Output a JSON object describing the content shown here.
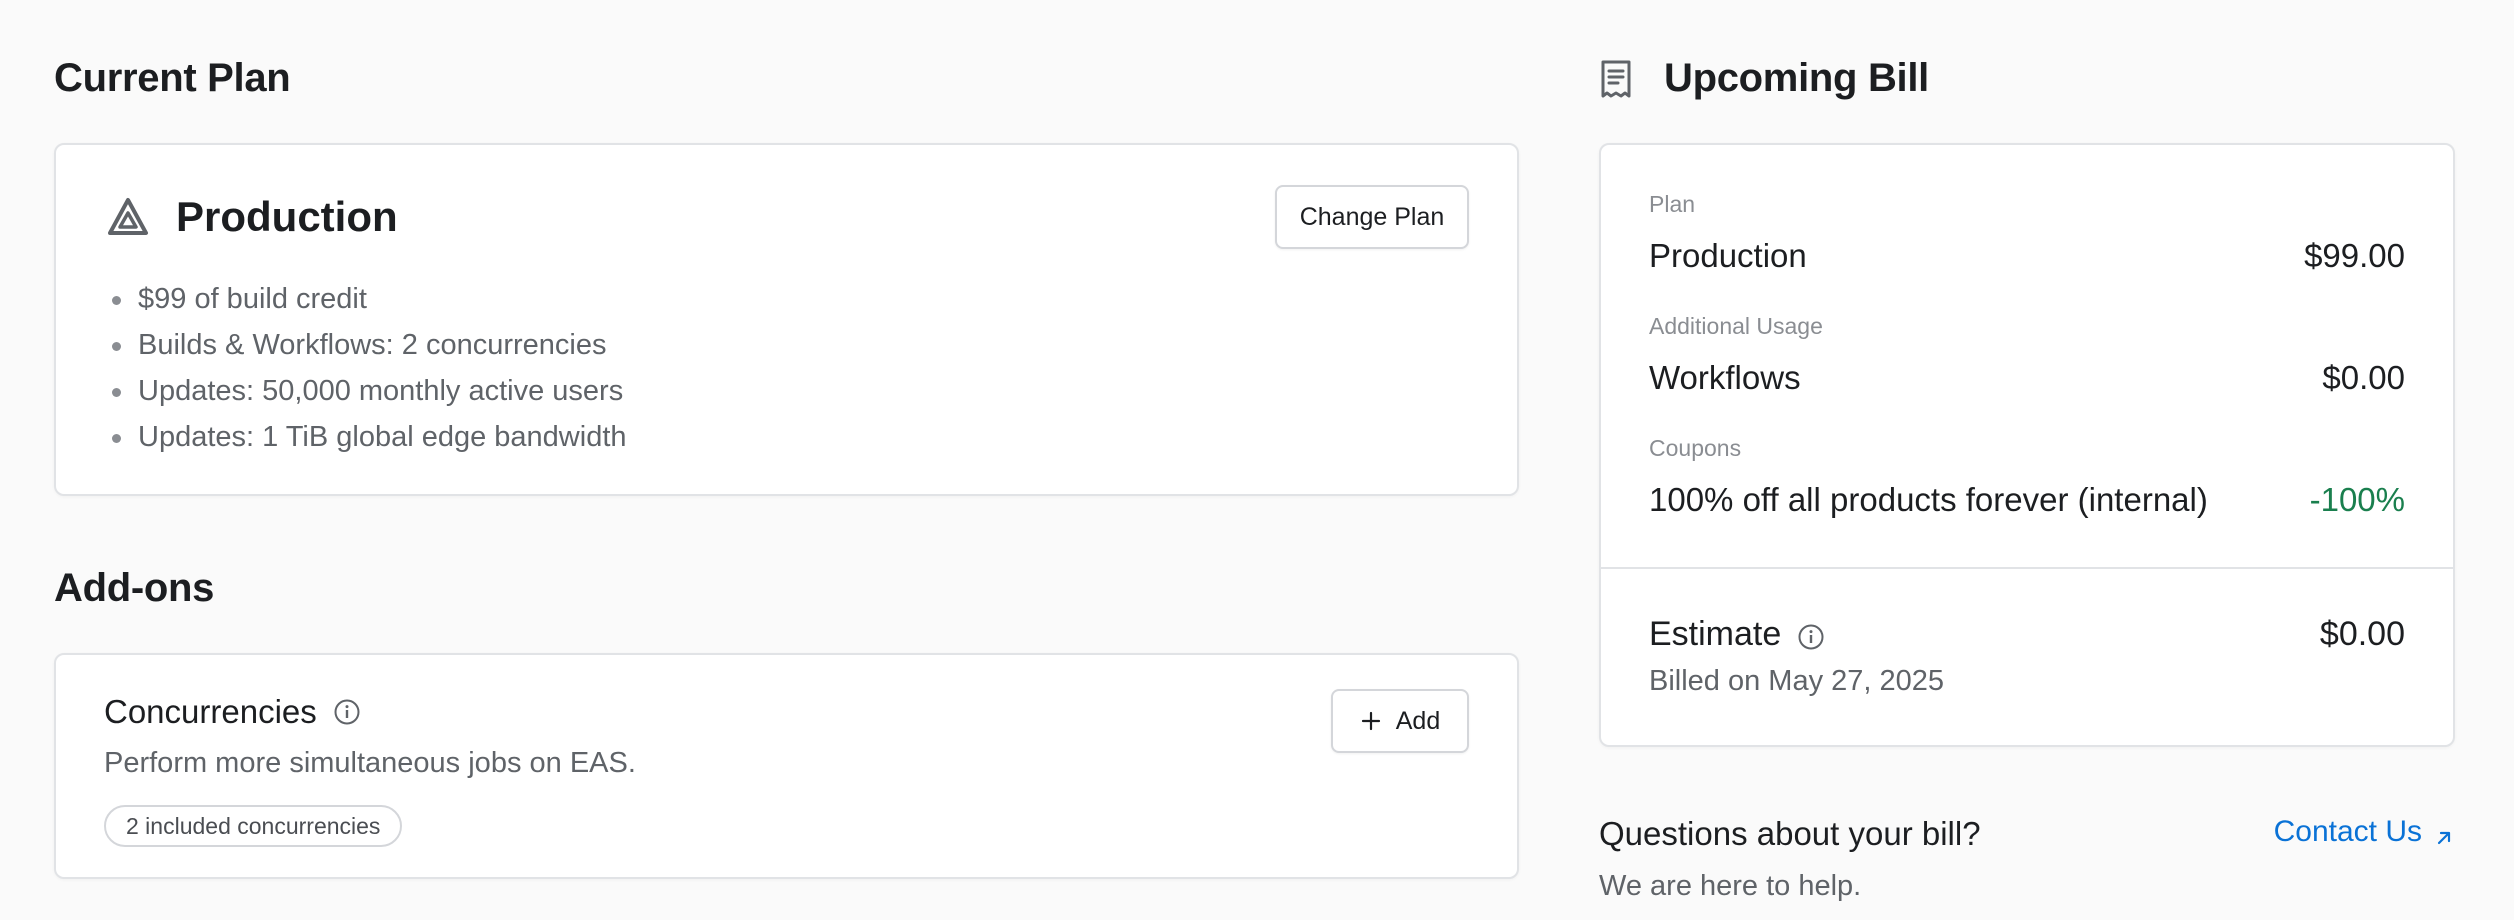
{
  "current_plan": {
    "section_title": "Current Plan",
    "plan_name": "Production",
    "change_plan_label": "Change Plan",
    "features": [
      "$99 of build credit",
      "Builds & Workflows: 2 concurrencies",
      "Updates: 50,000 monthly active users",
      "Updates: 1 TiB global edge bandwidth"
    ],
    "icon": "production-triangle-icon"
  },
  "addons": {
    "section_title": "Add-ons",
    "items": [
      {
        "title": "Concurrencies",
        "description": "Perform more simultaneous jobs on EAS.",
        "badge": "2 included concurrencies",
        "add_label": "Add",
        "icons": [
          "info-icon",
          "plus-icon"
        ]
      }
    ]
  },
  "upcoming_bill": {
    "section_title": "Upcoming Bill",
    "icon": "receipt-icon",
    "groups": [
      {
        "label": "Plan",
        "name": "Production",
        "amount": "$99.00"
      },
      {
        "label": "Additional Usage",
        "name": "Workflows",
        "amount": "$0.00"
      },
      {
        "label": "Coupons",
        "name": "100% off all products forever (internal)",
        "amount": "-100%"
      }
    ],
    "estimate_label": "Estimate",
    "estimate_amount": "$0.00",
    "billed_on": "Billed on May 27, 2025"
  },
  "help": {
    "question": "Questions about your bill?",
    "subtext": "We are here to help.",
    "contact_label": "Contact Us"
  },
  "colors": {
    "background": "#fafafa",
    "card_border": "#e1e3e6",
    "link": "#0a72d6",
    "discount": "#1a7f4e",
    "muted_text": "#5f6368"
  }
}
